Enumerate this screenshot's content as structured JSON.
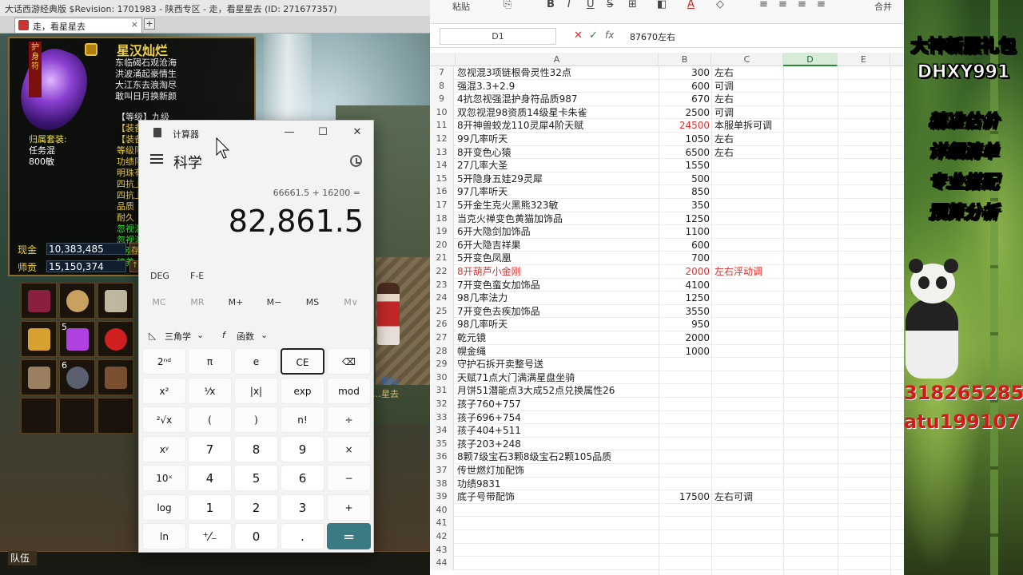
{
  "game": {
    "window_title": "大话西游经典版 $Revision: 1701983 - 陕西专区 - 走，看星星去 (ID: 271677357)",
    "tab_label": "走，看星星去",
    "tab_close": "×",
    "tab_add": "+",
    "item": {
      "name": "星汉灿烂",
      "guard_tag": "护身符",
      "poem": [
        "东临碣石观沧海",
        "洪波涌起豪情生",
        "大江东去浪淘尽",
        "敢叫日月换新颜"
      ],
      "level_line": "【等级】九级",
      "equip_lines": [
        "【装备",
        "【装备",
        "等级限",
        "功绩限",
        "明珠有",
        "四抗上",
        "四抗上",
        "品质",
        "耐久"
      ],
      "green_lines": [
        "忽视混",
        "忽视混",
        "加强混",
        "培养"
      ],
      "set_label": "归属套装:",
      "set_values": [
        "任务混",
        "800敏"
      ]
    },
    "money": {
      "cash_label": "现金",
      "cash_value": "10,383,485",
      "cash_btn": "存",
      "tutor_label": "师贡",
      "tutor_value": "15,150,374",
      "tutor_btn": "↑"
    },
    "inventory_counts": [
      "5",
      "6"
    ],
    "team_label": "队伍",
    "char_name_1": "…领袖",
    "char_name_2": "…星去"
  },
  "calculator": {
    "title": "计算器",
    "mode": "科学",
    "expression": "66661.5 + 16200 =",
    "result": "82,861.5",
    "angle_mode": "DEG",
    "fe_label": "F-E",
    "memory": [
      "MC",
      "MR",
      "M+",
      "M−",
      "MS",
      "M∨"
    ],
    "trig_label": "三角学",
    "func_label": "函数",
    "keys": [
      [
        "2ⁿᵈ",
        "π",
        "e",
        "CE",
        "⌫"
      ],
      [
        "x²",
        "¹⁄x",
        "|x|",
        "exp",
        "mod"
      ],
      [
        "²√x",
        "(",
        ")",
        "n!",
        "÷"
      ],
      [
        "xʸ",
        "7",
        "8",
        "9",
        "×"
      ],
      [
        "10ˣ",
        "4",
        "5",
        "6",
        "−"
      ],
      [
        "log",
        "1",
        "2",
        "3",
        "+"
      ],
      [
        "ln",
        "⁺⁄₋",
        "0",
        ".",
        "="
      ]
    ]
  },
  "sheet": {
    "ribbon": [
      "粘贴",
      "B",
      "I",
      "U",
      "S",
      "A",
      "合并"
    ],
    "namebox": "D1",
    "formula": "87670左右",
    "columns": [
      "A",
      "B",
      "C",
      "D",
      "E"
    ],
    "rows": [
      {
        "n": "7",
        "a": "忽视混3项链根骨灵性32点",
        "b": "300",
        "c": "左右"
      },
      {
        "n": "8",
        "a": "强混3.3+2.9",
        "b": "600",
        "c": "可调"
      },
      {
        "n": "9",
        "a": "4抗忽视强混护身符品质987",
        "b": "670",
        "c": "左右"
      },
      {
        "n": "10",
        "a": "双忽视混98资质14级星卡朱雀",
        "b": "2500",
        "c": "可调"
      },
      {
        "n": "11",
        "a": "8开神兽蛟龙110灵犀4阶天赋",
        "b": "24500",
        "c": "本服单拆可调",
        "b_red": true
      },
      {
        "n": "12",
        "a": "99几率听天",
        "b": "1050",
        "c": "左右"
      },
      {
        "n": "13",
        "a": "8开变色心猿",
        "b": "6500",
        "c": "左右"
      },
      {
        "n": "14",
        "a": "27几率大圣",
        "b": "1550",
        "c": ""
      },
      {
        "n": "15",
        "a": "5开隐身五娃29灵犀",
        "b": "500",
        "c": ""
      },
      {
        "n": "16",
        "a": "97几率听天",
        "b": "850",
        "c": ""
      },
      {
        "n": "17",
        "a": "5开金生克火黑熊323敏",
        "b": "350",
        "c": ""
      },
      {
        "n": "18",
        "a": "当克火禅变色黄猫加饰品",
        "b": "1250",
        "c": ""
      },
      {
        "n": "19",
        "a": "6开大隐剑加饰品",
        "b": "1100",
        "c": ""
      },
      {
        "n": "20",
        "a": "6开大隐吉祥果",
        "b": "600",
        "c": ""
      },
      {
        "n": "21",
        "a": "5开变色凤凰",
        "b": "700",
        "c": ""
      },
      {
        "n": "22",
        "a": "8开葫芦小金刚",
        "b": "2000",
        "c": "左右浮动调",
        "a_red": true,
        "b_red": true,
        "c_red": true
      },
      {
        "n": "23",
        "a": "7开变色蛮女加饰品",
        "b": "4100",
        "c": ""
      },
      {
        "n": "24",
        "a": "98几率法力",
        "b": "1250",
        "c": ""
      },
      {
        "n": "25",
        "a": "7开变色去疾加饰品",
        "b": "3550",
        "c": ""
      },
      {
        "n": "26",
        "a": "98几率听天",
        "b": "950",
        "c": ""
      },
      {
        "n": "27",
        "a": "乾元镜",
        "b": "2000",
        "c": ""
      },
      {
        "n": "28",
        "a": "幌金绳",
        "b": "1000",
        "c": ""
      },
      {
        "n": "29",
        "a": "守护石拆开卖整号送",
        "b": "",
        "c": ""
      },
      {
        "n": "30",
        "a": "天赋71点大门满满星盘坐骑",
        "b": "",
        "c": ""
      },
      {
        "n": "31",
        "a": "月饼51潜能点3大成52点兑换属性26",
        "b": "",
        "c": ""
      },
      {
        "n": "32",
        "a": "孩子760+757",
        "b": "",
        "c": ""
      },
      {
        "n": "33",
        "a": "孩子696+754",
        "b": "",
        "c": ""
      },
      {
        "n": "34",
        "a": "孩子404+511",
        "b": "",
        "c": ""
      },
      {
        "n": "35",
        "a": "孩子203+248",
        "b": "",
        "c": ""
      },
      {
        "n": "36",
        "a": "8颗7级宝石3颗8级宝石2颗105品质",
        "b": "",
        "c": ""
      },
      {
        "n": "37",
        "a": "传世燃灯加配饰",
        "b": "",
        "c": ""
      },
      {
        "n": "38",
        "a": "功绩9831",
        "b": "",
        "c": ""
      },
      {
        "n": "39",
        "a": "底子号带配饰",
        "b": "17500",
        "c": "左右可调"
      },
      {
        "n": "40",
        "a": "",
        "b": "",
        "c": ""
      },
      {
        "n": "41",
        "a": "",
        "b": "",
        "c": ""
      },
      {
        "n": "42",
        "a": "",
        "b": "",
        "c": ""
      },
      {
        "n": "43",
        "a": "",
        "b": "",
        "c": ""
      },
      {
        "n": "44",
        "a": "",
        "b": "",
        "c": ""
      }
    ]
  },
  "banner": {
    "line1": "大神新服礼包",
    "line2": "DHXY991",
    "line3": "精准估价",
    "line4": "详细清单",
    "line5": "专业搭配",
    "line6": "预算分析",
    "contact1": "318265285",
    "contact2": "atu199107"
  }
}
